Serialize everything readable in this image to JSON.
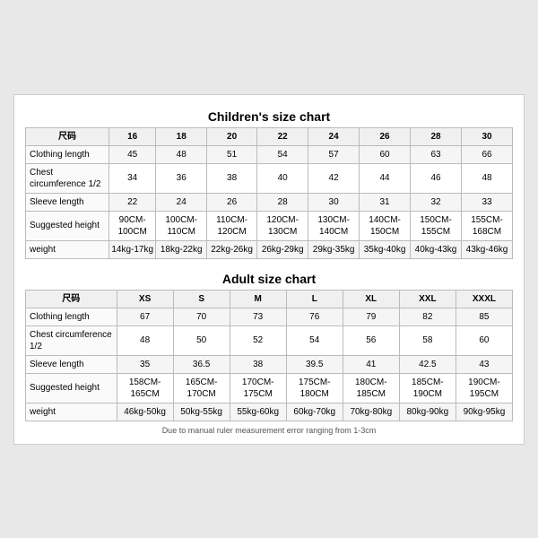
{
  "children_title": "Children's size chart",
  "adult_title": "Adult size chart",
  "note": "Due to manual ruler measurement error ranging from 1-3cm",
  "children": {
    "headers": [
      "尺码",
      "16",
      "18",
      "20",
      "22",
      "24",
      "26",
      "28",
      "30"
    ],
    "rows": [
      {
        "label": "Clothing length",
        "values": [
          "45",
          "48",
          "51",
          "54",
          "57",
          "60",
          "63",
          "66"
        ]
      },
      {
        "label": "Chest circumference 1/2",
        "values": [
          "34",
          "36",
          "38",
          "40",
          "42",
          "44",
          "46",
          "48"
        ]
      },
      {
        "label": "Sleeve length",
        "values": [
          "22",
          "24",
          "26",
          "28",
          "30",
          "31",
          "32",
          "33"
        ]
      },
      {
        "label": "Suggested height",
        "values": [
          "90CM-100CM",
          "100CM-110CM",
          "110CM-120CM",
          "120CM-130CM",
          "130CM-140CM",
          "140CM-150CM",
          "150CM-155CM",
          "155CM-168CM"
        ]
      },
      {
        "label": "weight",
        "values": [
          "14kg-17kg",
          "18kg-22kg",
          "22kg-26kg",
          "26kg-29kg",
          "29kg-35kg",
          "35kg-40kg",
          "40kg-43kg",
          "43kg-46kg"
        ]
      }
    ]
  },
  "adult": {
    "headers": [
      "尺码",
      "XS",
      "S",
      "M",
      "L",
      "XL",
      "XXL",
      "XXXL"
    ],
    "rows": [
      {
        "label": "Clothing length",
        "values": [
          "67",
          "70",
          "73",
          "76",
          "79",
          "82",
          "85"
        ]
      },
      {
        "label": "Chest circumference 1/2",
        "values": [
          "48",
          "50",
          "52",
          "54",
          "56",
          "58",
          "60"
        ]
      },
      {
        "label": "Sleeve length",
        "values": [
          "35",
          "36.5",
          "38",
          "39.5",
          "41",
          "42.5",
          "43"
        ]
      },
      {
        "label": "Suggested height",
        "values": [
          "158CM-165CM",
          "165CM-170CM",
          "170CM-175CM",
          "175CM-180CM",
          "180CM-185CM",
          "185CM-190CM",
          "190CM-195CM"
        ]
      },
      {
        "label": "weight",
        "values": [
          "46kg-50kg",
          "50kg-55kg",
          "55kg-60kg",
          "60kg-70kg",
          "70kg-80kg",
          "80kg-90kg",
          "90kg-95kg"
        ]
      }
    ]
  }
}
